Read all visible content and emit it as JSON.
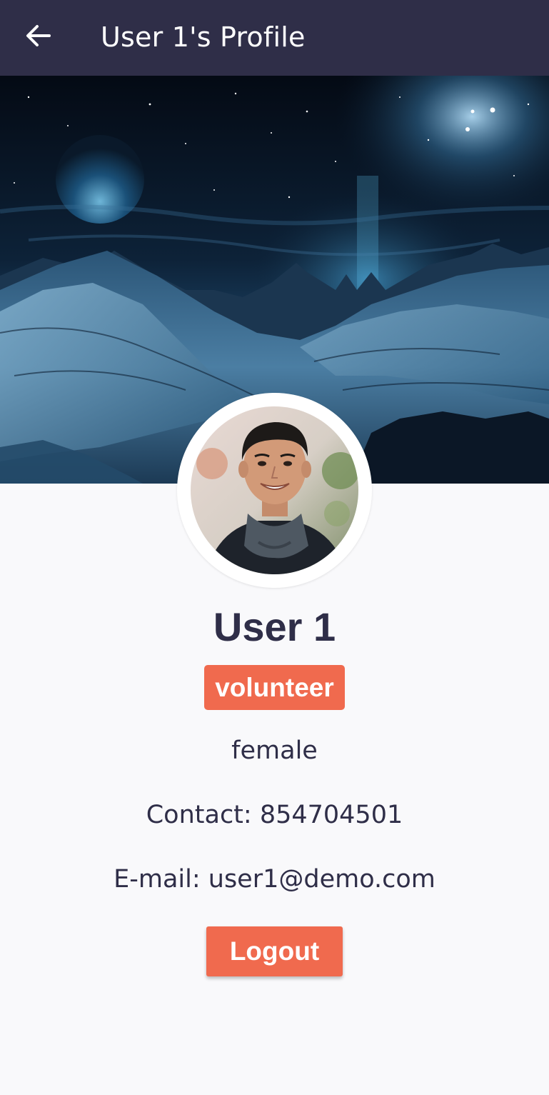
{
  "appbar": {
    "title": "User 1's Profile",
    "back_icon": "arrow-left-icon",
    "background": "#2f2e48"
  },
  "cover": {
    "description_icon": "mountain-night-sky-image"
  },
  "profile": {
    "avatar_icon": "user-avatar-photo",
    "name": "User 1",
    "role": "volunteer",
    "gender": "female",
    "contact": "Contact: 854704501",
    "email": "E-mail: user1@demo.com"
  },
  "actions": {
    "logout_label": "Logout"
  },
  "colors": {
    "accent": "#f06a4e",
    "text_primary": "#2f2e48",
    "page_background": "#f9f9fb"
  }
}
